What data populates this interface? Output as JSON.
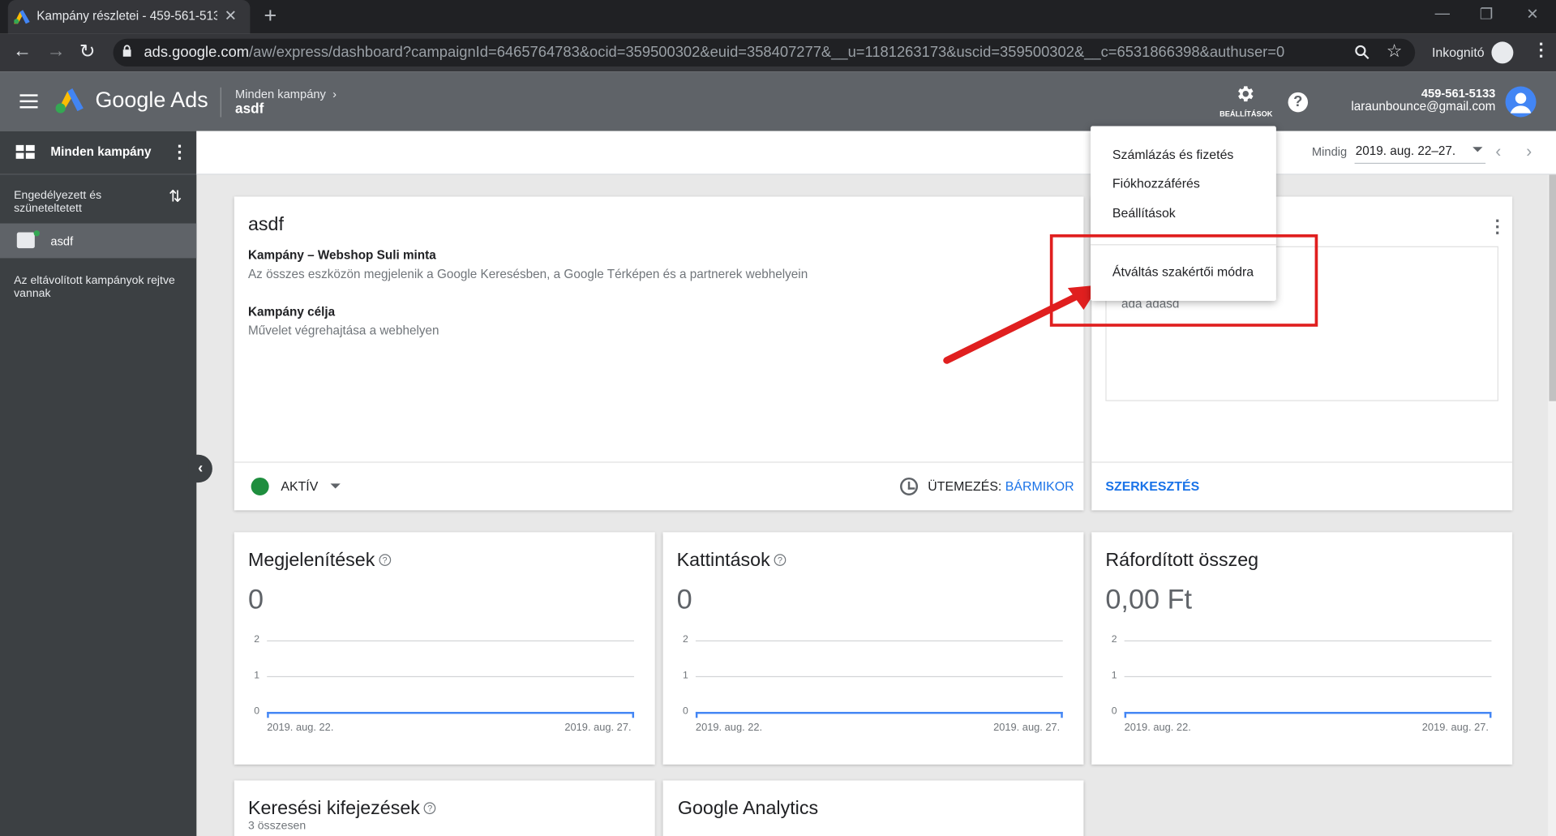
{
  "browser": {
    "tab_title": "Kampány részletei - 459-561-513",
    "url_main": "ads.google.com",
    "url_rest": "/aw/express/dashboard?campaignId=6465764783&ocid=359500302&euid=358407277&__u=1181263173&uscid=359500302&__c=6531866398&authuser=0",
    "incognito_label": "Inkognitó"
  },
  "header": {
    "product": "Google Ads",
    "breadcrumb_parent": "Minden kampány",
    "breadcrumb_current": "asdf",
    "settings_label": "BEÁLLÍTÁSOK",
    "account_id": "459-561-5133",
    "account_email": "laraunbounce@gmail.com"
  },
  "sidebar": {
    "all_campaigns": "Minden kampány",
    "filter_label": "Engedélyezett és szüneteltetett",
    "campaign": "asdf",
    "removed_note": "Az eltávolított kampányok rejtve vannak"
  },
  "datebar": {
    "prefix": "Mindig",
    "range": "2019. aug. 22–27."
  },
  "settings_menu": {
    "items": [
      "Számlázás és fizetés",
      "Fiókhozzáférés",
      "Beállítások",
      "Átváltás szakértői módra"
    ]
  },
  "campaign_card": {
    "title": "asdf",
    "campaign_heading": "Kampány – Webshop Suli minta",
    "campaign_desc": "Az összes eszközön megjelenik a Google Keresésben, a Google Térképen és a partnerek webhelyein",
    "goal_heading": "Kampány célja",
    "goal_desc": "Művelet végrehajtása a webhelyen",
    "status": "AKTÍV",
    "schedule_label": "ÜTEMEZÉS: ",
    "schedule_value": "BÁRMIKOR",
    "status_color": "#1e8e3e"
  },
  "ad_card": {
    "ad_text": "ada adasd",
    "edit_label": "SZERKESZTÉS"
  },
  "metrics": [
    {
      "title": "Megjelenítések",
      "value": "0",
      "y_ticks": [
        "2",
        "1",
        "0"
      ],
      "x_start": "2019. aug. 22.",
      "x_end": "2019. aug. 27."
    },
    {
      "title": "Kattintások",
      "value": "0",
      "y_ticks": [
        "2",
        "1",
        "0"
      ],
      "x_start": "2019. aug. 22.",
      "x_end": "2019. aug. 27."
    },
    {
      "title": "Ráfordított összeg",
      "value": "0,00 Ft",
      "y_ticks": [
        "2",
        "1",
        "0"
      ],
      "x_start": "2019. aug. 22.",
      "x_end": "2019. aug. 27."
    }
  ],
  "bottom_cards": {
    "keywords_title": "Keresési kifejezések",
    "keywords_sub": "3 összesen",
    "analytics_title": "Google Analytics"
  },
  "colors": {
    "accent": "#1a73e8",
    "annotation": "#e01f1f",
    "line_series": "#4285f4"
  }
}
